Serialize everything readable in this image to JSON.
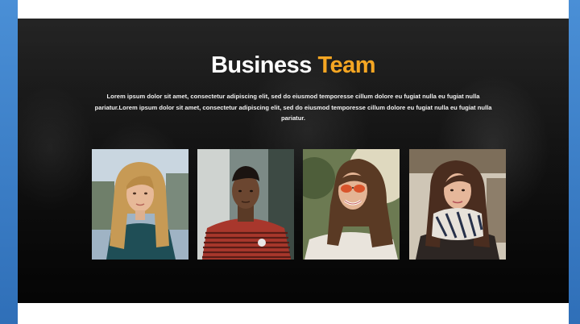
{
  "hero": {
    "title_main": "Business",
    "title_accent": "Team",
    "description": "Lorem ipsum dolor sit amet, consectetur adipiscing elit, sed do eiusmod temporesse cillum dolore eu fugiat nulla eu fugiat nulla pariatur.Lorem ipsum dolor sit amet, consectetur adipiscing elit, sed do eiusmod temporesse cillum dolore eu fugiat nulla eu fugiat nulla pariatur."
  },
  "colors": {
    "accent": "#f5a623",
    "frame": "#3f83cc",
    "hero_bg": "#1a1a1a"
  },
  "team": [
    {
      "photo": "woman-long-blonde-hair-portrait"
    },
    {
      "photo": "man-red-striped-shirt-portrait"
    },
    {
      "photo": "woman-sunglasses-portrait"
    },
    {
      "photo": "woman-striped-scarf-portrait"
    }
  ]
}
